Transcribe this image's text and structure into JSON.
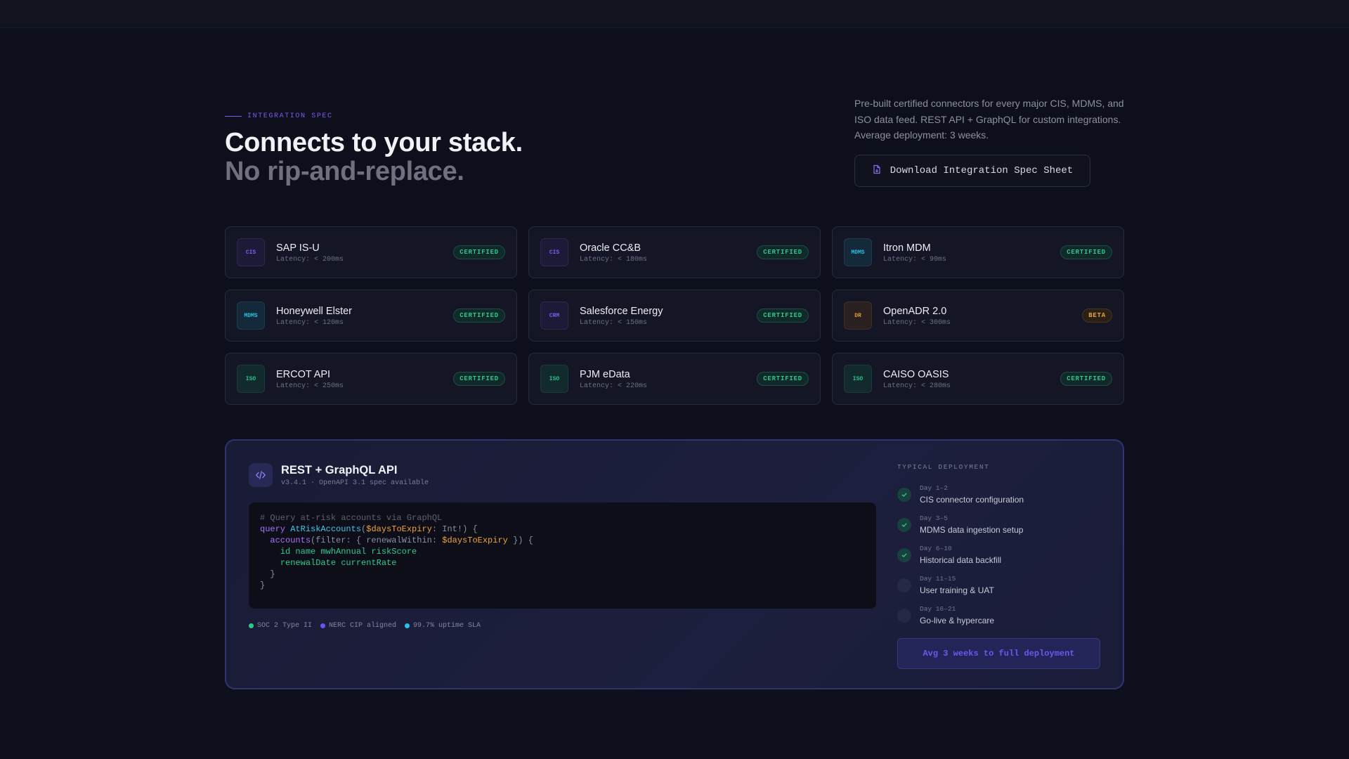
{
  "header": {
    "eyebrow": "INTEGRATION SPEC",
    "title_line1": "Connects to your stack.",
    "title_line2": "No rip-and-replace.",
    "intro": "Pre-built certified connectors for every major CIS, MDMS, and ISO data feed. REST API + GraphQL for custom integrations. Average deployment: 3 weeks.",
    "download_label": "Download Integration Spec Sheet"
  },
  "connectors": [
    {
      "tag": "CIS",
      "kind": "cis",
      "name": "SAP IS-U",
      "latency": "Latency: < 200ms",
      "status": "CERTIFIED",
      "status_kind": "certified"
    },
    {
      "tag": "CIS",
      "kind": "cis",
      "name": "Oracle CC&B",
      "latency": "Latency: < 180ms",
      "status": "CERTIFIED",
      "status_kind": "certified"
    },
    {
      "tag": "MDMS",
      "kind": "mdms",
      "name": "Itron MDM",
      "latency": "Latency: < 90ms",
      "status": "CERTIFIED",
      "status_kind": "certified"
    },
    {
      "tag": "MDMS",
      "kind": "mdms",
      "name": "Honeywell Elster",
      "latency": "Latency: < 120ms",
      "status": "CERTIFIED",
      "status_kind": "certified"
    },
    {
      "tag": "CRM",
      "kind": "crm",
      "name": "Salesforce Energy",
      "latency": "Latency: < 150ms",
      "status": "CERTIFIED",
      "status_kind": "certified"
    },
    {
      "tag": "DR",
      "kind": "dr",
      "name": "OpenADR 2.0",
      "latency": "Latency: < 300ms",
      "status": "BETA",
      "status_kind": "beta"
    },
    {
      "tag": "ISO",
      "kind": "iso",
      "name": "ERCOT API",
      "latency": "Latency: < 250ms",
      "status": "CERTIFIED",
      "status_kind": "certified"
    },
    {
      "tag": "ISO",
      "kind": "iso",
      "name": "PJM eData",
      "latency": "Latency: < 220ms",
      "status": "CERTIFIED",
      "status_kind": "certified"
    },
    {
      "tag": "ISO",
      "kind": "iso",
      "name": "CAISO OASIS",
      "latency": "Latency: < 280ms",
      "status": "CERTIFIED",
      "status_kind": "certified"
    }
  ],
  "api": {
    "title": "REST + GraphQL API",
    "subtitle": "v3.4.1 · OpenAPI 3.1 spec available",
    "code": {
      "comment": "# Query at-risk accounts via GraphQL",
      "kw_query": "query",
      "fn_name": "AtRiskAccounts",
      "paren_open": "(",
      "var_days": "$daysToExpiry",
      "type_sig": ": Int!) {",
      "kw_accounts": "accounts",
      "filter_open": "(filter: { renewalWithin: ",
      "var_days2": "$daysToExpiry",
      "filter_close": " }) {",
      "fields1": "id name mwhAnnual riskScore",
      "fields2": "renewalDate currentRate",
      "close_inner": "}",
      "close_outer": "}"
    },
    "compliance": [
      {
        "label": "SOC 2 Type II",
        "color": "#2fc98e"
      },
      {
        "label": "NERC CIP aligned",
        "color": "#6a54f0"
      },
      {
        "label": "99.7% uptime SLA",
        "color": "#27c2e6"
      }
    ]
  },
  "deployment": {
    "title": "TYPICAL DEPLOYMENT",
    "steps": [
      {
        "day": "Day 1–2",
        "label": "CIS connector configuration",
        "done": true
      },
      {
        "day": "Day 3–5",
        "label": "MDMS data ingestion setup",
        "done": true
      },
      {
        "day": "Day 6–10",
        "label": "Historical data backfill",
        "done": true
      },
      {
        "day": "Day 11–15",
        "label": "User training & UAT",
        "done": false
      },
      {
        "day": "Day 16–21",
        "label": "Go-live & hypercare",
        "done": false
      }
    ],
    "cta": "Avg 3 weeks to full deployment"
  }
}
